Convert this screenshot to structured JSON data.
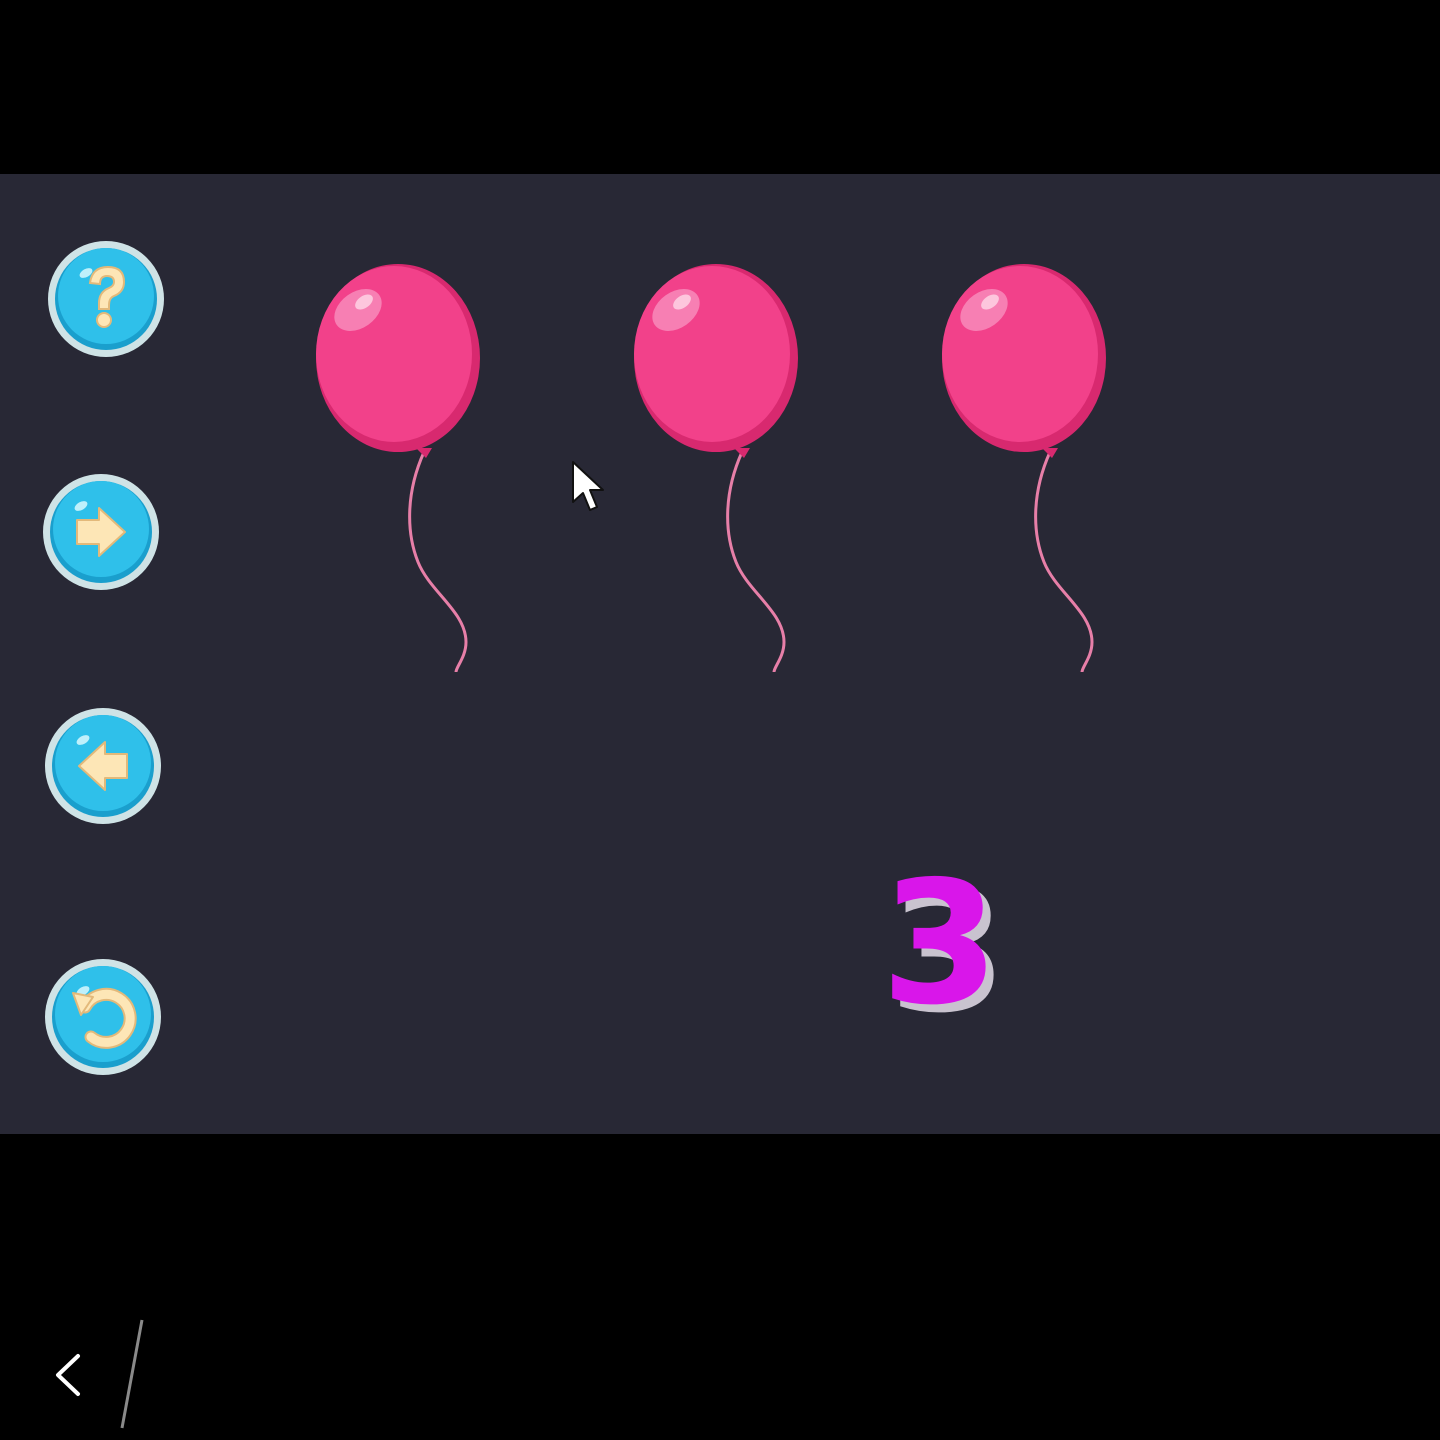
{
  "game": {
    "count_value": "3",
    "balloon_count": 3,
    "balloon_color": "#f23d86",
    "number_color": "#d916ea",
    "button_color": "#2bb8e2",
    "background_color": "#282835"
  },
  "sidebar": {
    "buttons": [
      {
        "icon": "question-mark-icon"
      },
      {
        "icon": "arrow-right-icon"
      },
      {
        "icon": "arrow-left-icon"
      },
      {
        "icon": "refresh-icon"
      }
    ]
  },
  "system_nav": {
    "back_icon": "chevron-left-icon"
  }
}
